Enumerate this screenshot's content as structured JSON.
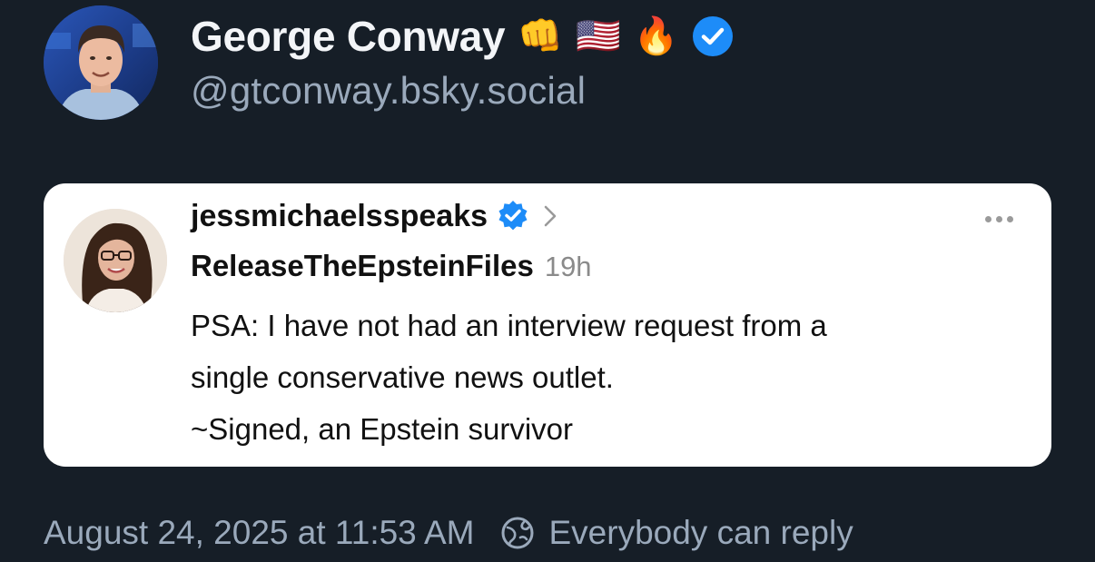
{
  "author": {
    "name": "George Conway",
    "emojis": [
      "👊",
      "🇺🇸",
      "🔥"
    ],
    "handle": "@gtconway.bsky.social",
    "verified_icon": "verified-badge-icon"
  },
  "quoted_post": {
    "username": "jessmichaelsspeaks",
    "display_name": "ReleaseTheEpsteinFiles",
    "time": "19h",
    "text_lines": [
      "PSA: I have not had an interview request from a",
      "single conservative news outlet.",
      "~Signed, an Epstein survivor"
    ],
    "more_icon": "more-options-icon"
  },
  "footer": {
    "timestamp": "August 24, 2025 at 11:53 AM",
    "reply_setting": "Everybody can reply",
    "reply_icon": "globe-icon"
  },
  "colors": {
    "background": "#161e27",
    "card": "#ffffff",
    "muted_text": "#9aa9bb",
    "verified_blue": "#1d8cf8"
  }
}
